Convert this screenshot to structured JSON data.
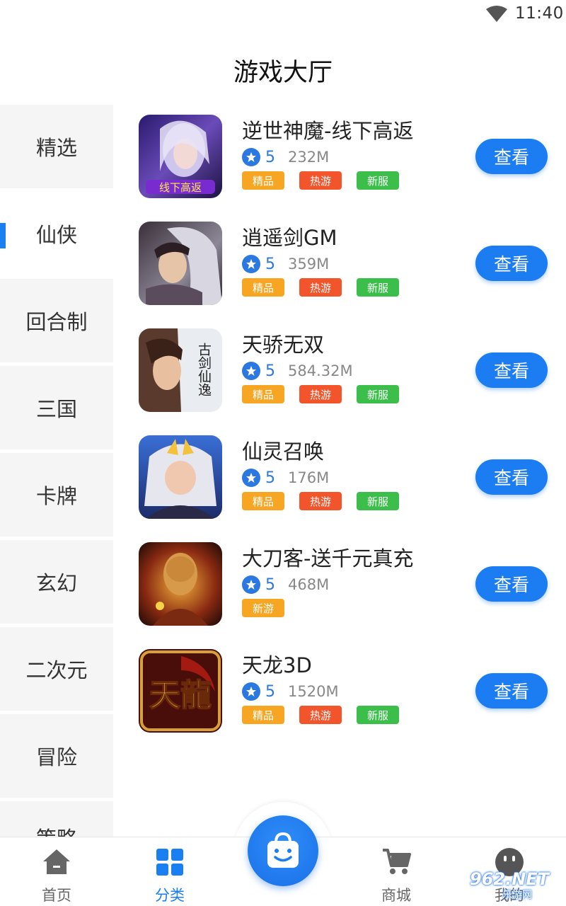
{
  "status_bar": {
    "time": "11:40",
    "wifi_icon": "wifi-icon"
  },
  "header": {
    "title": "游戏大厅"
  },
  "sidebar": {
    "active_index": 1,
    "items": [
      {
        "label": "精选"
      },
      {
        "label": "仙侠"
      },
      {
        "label": "回合制"
      },
      {
        "label": "三国"
      },
      {
        "label": "卡牌"
      },
      {
        "label": "玄幻"
      },
      {
        "label": "二次元"
      },
      {
        "label": "冒险"
      },
      {
        "label": "策略"
      }
    ]
  },
  "games": [
    {
      "name": "逆世神魔-线下高返",
      "score": "5",
      "size": "232M",
      "tags": [
        "精品",
        "热游",
        "新服"
      ],
      "button": "查看"
    },
    {
      "name": "逍遥剑GM",
      "score": "5",
      "size": "359M",
      "tags": [
        "精品",
        "热游",
        "新服"
      ],
      "button": "查看"
    },
    {
      "name": "天骄无双",
      "score": "5",
      "size": "584.32M",
      "tags": [
        "精品",
        "热游",
        "新服"
      ],
      "button": "查看"
    },
    {
      "name": "仙灵召唤",
      "score": "5",
      "size": "176M",
      "tags": [
        "精品",
        "热游",
        "新服"
      ],
      "button": "查看"
    },
    {
      "name": "大刀客-送千元真充",
      "score": "5",
      "size": "468M",
      "tags": [
        "新游"
      ],
      "button": "查看"
    },
    {
      "name": "天龙3D",
      "score": "5",
      "size": "1520M",
      "tags": [
        "精品",
        "热游",
        "新服"
      ],
      "button": "查看"
    }
  ],
  "thumb_art": {
    "game_1_caption": "线下高返",
    "game_3_caption": "古剑仙逸",
    "game_6_caption": "天龍"
  },
  "tag_colors": {
    "精品": "#f7a623",
    "热游": "#f2552b",
    "新服": "#3bbf4a",
    "新游": "#f7a623"
  },
  "bottom_nav": {
    "items": [
      {
        "label": "首页",
        "icon": "home-icon"
      },
      {
        "label": "分类",
        "icon": "grid-icon"
      },
      {
        "label": "",
        "icon": "shopping-bag-icon"
      },
      {
        "label": "商城",
        "icon": "cart-icon"
      },
      {
        "label": "我的",
        "icon": "smiley-icon"
      }
    ],
    "active_index": 1
  },
  "watermark": {
    "text": "962.NET",
    "sub": "乐游网"
  },
  "colors": {
    "accent": "#1c7cf2",
    "sidebar_bg": "#f5f5f5"
  }
}
